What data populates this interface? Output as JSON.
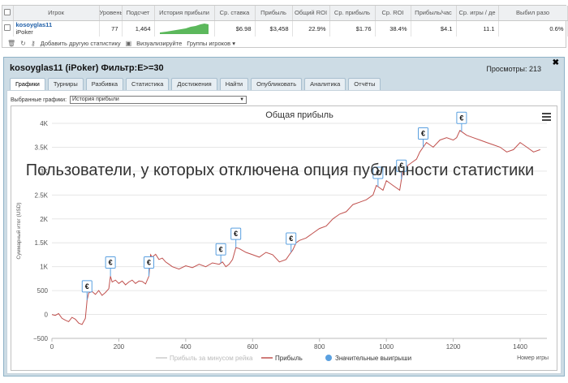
{
  "stats": {
    "columns": [
      "",
      "Игрок",
      "Уровень",
      "Подсчет",
      "История прибыли",
      "Ср. ставка",
      "Прибыль",
      "Общий ROI",
      "Ср. прибыль",
      "Ср. ROI",
      "Прибыль/час",
      "Ср. игры / де",
      "Выбил разо"
    ],
    "row": {
      "player": "kosoyglas11",
      "site": "iPoker",
      "level": "77",
      "count": "1,464",
      "avg_stake": "$6.98",
      "profit": "$3,458",
      "total_roi": "22.9%",
      "avg_profit": "$1.76",
      "avg_roi": "38.4%",
      "profit_hour": "$4.1",
      "games_day": "11.1",
      "knockouts": "0.6%"
    },
    "toolbar": {
      "add_label": "Добавить другую статистику",
      "visualize_label": "Визуализируйте",
      "groups_label": "Группы игроков"
    }
  },
  "panel": {
    "title": "kosoyglas11 (iPoker) Фильтр:E>=30",
    "views": "Просмотры: 213",
    "tabs": [
      "Графики",
      "Турниры",
      "Разбивка",
      "Статистика",
      "Достижения",
      "Найти",
      "Опубликовать",
      "Аналитика",
      "Отчёты"
    ],
    "active_tab": 0,
    "select_label": "Выбранные графики:",
    "select_value": "История прибыли"
  },
  "overlay_text": "Пользователи, у которых отключена опция публичности статистики",
  "chart_data": {
    "type": "line",
    "title": "Общая прибыль",
    "xlabel": "Номер игры",
    "ylabel": "Суммарный итог (USD)",
    "xlim": [
      0,
      1480
    ],
    "ylim": [
      -500,
      4000
    ],
    "x_ticks": [
      0,
      200,
      400,
      600,
      800,
      1000,
      1200,
      1400
    ],
    "y_ticks": [
      -500,
      0,
      500,
      1000,
      1500,
      2000,
      2500,
      3000,
      3500,
      4000
    ],
    "y_tick_labels": [
      "−500",
      "0",
      "500",
      "1K",
      "1.5K",
      "2K",
      "2.5K",
      "3K",
      "3.5K",
      "4K"
    ],
    "legend": [
      "Прибыль за минусом рейка",
      "Прибыль",
      "Значительные выигрыши"
    ],
    "legend_colors": [
      "#cccccc",
      "#c0504d",
      "#5aa0e0"
    ],
    "legend_position": "bottom",
    "series": [
      {
        "name": "Прибыль",
        "color": "#c0504d",
        "x": [
          0,
          10,
          20,
          30,
          40,
          50,
          60,
          70,
          80,
          90,
          100,
          105,
          110,
          120,
          130,
          140,
          150,
          160,
          170,
          175,
          180,
          190,
          200,
          210,
          220,
          230,
          240,
          250,
          260,
          270,
          280,
          290,
          295,
          300,
          310,
          320,
          330,
          340,
          350,
          360,
          380,
          400,
          420,
          440,
          460,
          480,
          500,
          510,
          520,
          530,
          540,
          550,
          560,
          580,
          600,
          620,
          640,
          660,
          680,
          700,
          710,
          720,
          730,
          740,
          760,
          780,
          800,
          820,
          840,
          860,
          880,
          900,
          920,
          940,
          960,
          970,
          980,
          990,
          1000,
          1010,
          1020,
          1030,
          1040,
          1050,
          1060,
          1070,
          1080,
          1090,
          1100,
          1110,
          1120,
          1130,
          1140,
          1160,
          1180,
          1200,
          1210,
          1220,
          1240,
          1260,
          1280,
          1300,
          1320,
          1340,
          1360,
          1380,
          1400,
          1420,
          1440,
          1460
        ],
        "values": [
          0,
          -20,
          20,
          -80,
          -120,
          -150,
          -60,
          -100,
          -180,
          -210,
          -80,
          300,
          450,
          480,
          420,
          500,
          400,
          460,
          540,
          800,
          680,
          720,
          650,
          700,
          620,
          680,
          720,
          650,
          700,
          690,
          640,
          800,
          1250,
          1200,
          1260,
          1150,
          1180,
          1100,
          1050,
          1000,
          950,
          1020,
          980,
          1050,
          1000,
          1080,
          1050,
          1100,
          1000,
          1050,
          1150,
          1400,
          1380,
          1300,
          1250,
          1200,
          1300,
          1250,
          1100,
          1150,
          1250,
          1350,
          1500,
          1550,
          1600,
          1700,
          1800,
          1850,
          2000,
          2100,
          2150,
          2300,
          2350,
          2400,
          2500,
          2700,
          2650,
          2600,
          2800,
          2750,
          2700,
          2650,
          2600,
          3050,
          3100,
          3150,
          3200,
          3250,
          3400,
          3500,
          3600,
          3550,
          3500,
          3650,
          3700,
          3650,
          3700,
          3850,
          3750,
          3700,
          3650,
          3600,
          3550,
          3500,
          3400,
          3450,
          3600,
          3500,
          3400,
          3450
        ]
      }
    ],
    "big_wins_x": [
      105,
      175,
      290,
      505,
      550,
      715,
      975,
      1045,
      1110,
      1225
    ]
  }
}
